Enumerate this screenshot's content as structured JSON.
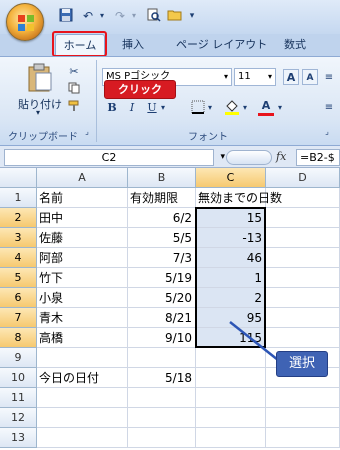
{
  "ribbon": {
    "tabs": [
      "ホーム",
      "挿入",
      "ページ レイアウト",
      "数式"
    ],
    "font_name": "MS Pゴシック",
    "font_size": "11",
    "paste_label": "貼り付け",
    "clipboard_label": "クリップボード",
    "font_group_label": "フォント",
    "bold": "B",
    "italic": "I",
    "underline": "U",
    "grow_font": "A",
    "shrink_font": "A",
    "font_color": "A"
  },
  "callouts": {
    "click": "クリック",
    "select": "選択"
  },
  "formula_bar": {
    "name_box": "C2",
    "fx": "fx",
    "formula": "=B2-$"
  },
  "sheet": {
    "columns": [
      "A",
      "B",
      "C",
      "D"
    ],
    "rows": [
      "1",
      "2",
      "3",
      "4",
      "5",
      "6",
      "7",
      "8",
      "9",
      "10",
      "11",
      "12",
      "13"
    ],
    "header": {
      "a": "名前",
      "b": "有効期限",
      "c": "無効までの日数"
    },
    "data": [
      {
        "name": "田中",
        "date": "6/2",
        "days": "15"
      },
      {
        "name": "佐藤",
        "date": "5/5",
        "days": "-13"
      },
      {
        "name": "阿部",
        "date": "7/3",
        "days": "46"
      },
      {
        "name": "竹下",
        "date": "5/19",
        "days": "1"
      },
      {
        "name": "小泉",
        "date": "5/20",
        "days": "2"
      },
      {
        "name": "青木",
        "date": "8/21",
        "days": "95"
      },
      {
        "name": "高橋",
        "date": "9/10",
        "days": "115"
      }
    ],
    "today_label": "今日の日付",
    "today_value": "5/18"
  }
}
